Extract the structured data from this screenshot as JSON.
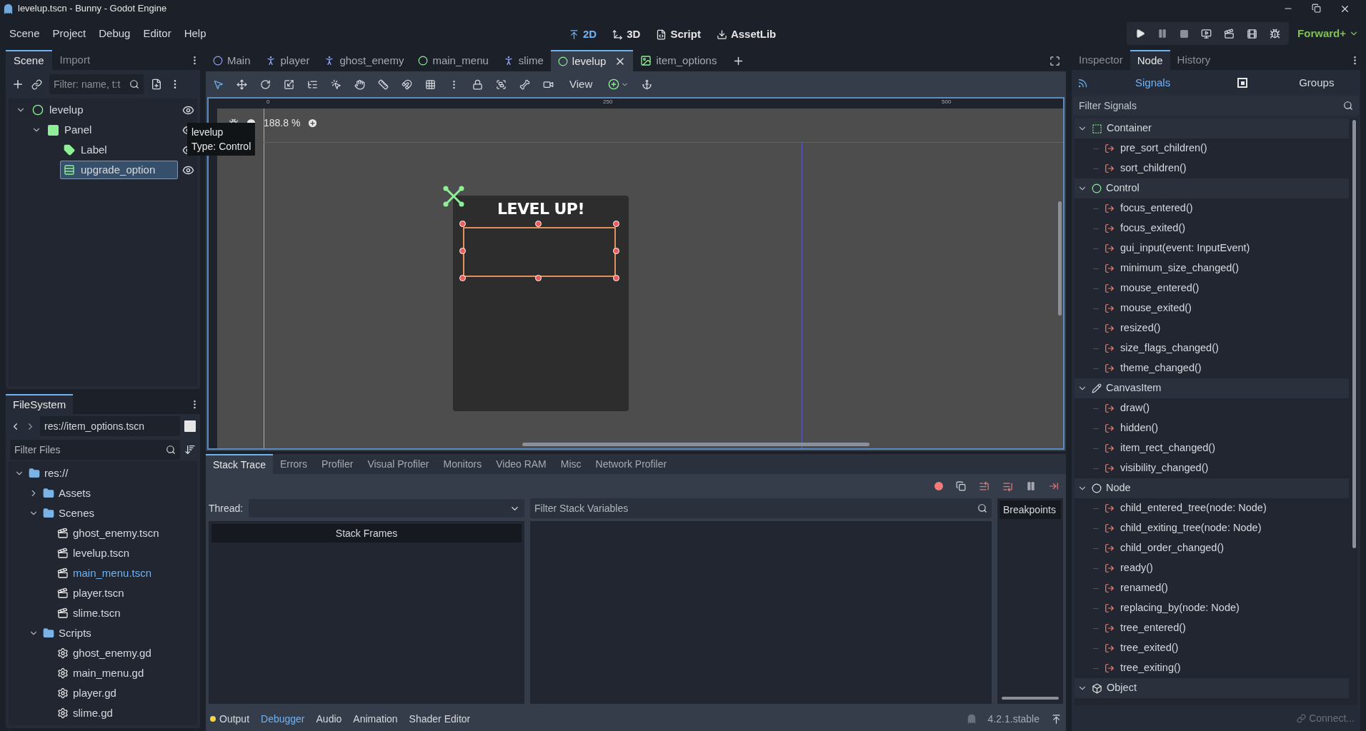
{
  "window": {
    "title": "levelup.tscn - Bunny - Godot Engine"
  },
  "menus": [
    "Scene",
    "Project",
    "Debug",
    "Editor",
    "Help"
  ],
  "main_screens": [
    {
      "label": "2D",
      "kind": "twod",
      "selected": true
    },
    {
      "label": "3D",
      "kind": "threed",
      "selected": false
    },
    {
      "label": "Script",
      "kind": "script",
      "selected": false
    },
    {
      "label": "AssetLib",
      "kind": "assetlib",
      "selected": false
    }
  ],
  "renderer": "Forward+",
  "scene_dock": {
    "tabs": [
      {
        "label": "Scene",
        "selected": true
      },
      {
        "label": "Import",
        "selected": false
      }
    ],
    "placeholder": "Filter: name, t:t",
    "tree": [
      {
        "name": "levelup",
        "kind": "control",
        "expanded": true,
        "selected": false,
        "children": [
          {
            "name": "Panel",
            "kind": "panel",
            "expanded": true,
            "selected": false,
            "children": [
              {
                "name": "Label",
                "kind": "label",
                "selected": false
              },
              {
                "name": "upgrade_option",
                "kind": "vbox",
                "selected": true
              }
            ]
          }
        ]
      }
    ],
    "tooltip": [
      "levelup",
      "Type: Control"
    ]
  },
  "scene_tabs": [
    {
      "label": "Main",
      "kind": "node2d",
      "selected": false
    },
    {
      "label": "player",
      "kind": "character",
      "selected": false
    },
    {
      "label": "ghost_enemy",
      "kind": "character",
      "selected": false
    },
    {
      "label": "main_menu",
      "kind": "control",
      "selected": false
    },
    {
      "label": "slime",
      "kind": "character",
      "selected": false
    },
    {
      "label": "levelup",
      "kind": "control",
      "selected": true
    },
    {
      "label": "item_options",
      "kind": "texture",
      "selected": false
    }
  ],
  "viewport": {
    "view_menu": "View",
    "zoom": "188.8 %",
    "ruler_marks": [
      "0",
      "250",
      "500"
    ],
    "panel_title": "LEVEL UP!"
  },
  "filesystem": {
    "tab": "FileSystem",
    "path": "res://item_options.tscn",
    "placeholder": "Filter Files",
    "tree": [
      {
        "name": "res://",
        "kind": "folder",
        "expanded": true,
        "highlighted": false,
        "children": [
          {
            "name": "Assets",
            "kind": "folder",
            "expanded": false,
            "highlighted": false
          },
          {
            "name": "Scenes",
            "kind": "folder",
            "expanded": true,
            "highlighted": false,
            "children": [
              {
                "name": "ghost_enemy.tscn",
                "kind": "scene",
                "highlighted": false
              },
              {
                "name": "levelup.tscn",
                "kind": "scene",
                "highlighted": false
              },
              {
                "name": "main_menu.tscn",
                "kind": "scene",
                "highlighted": true
              },
              {
                "name": "player.tscn",
                "kind": "scene",
                "highlighted": false
              },
              {
                "name": "slime.tscn",
                "kind": "scene",
                "highlighted": false
              }
            ]
          },
          {
            "name": "Scripts",
            "kind": "folder",
            "expanded": true,
            "highlighted": false,
            "children": [
              {
                "name": "ghost_enemy.gd",
                "kind": "script",
                "highlighted": false
              },
              {
                "name": "main_menu.gd",
                "kind": "script",
                "highlighted": false
              },
              {
                "name": "player.gd",
                "kind": "script",
                "highlighted": false
              },
              {
                "name": "slime.gd",
                "kind": "script",
                "highlighted": false
              }
            ]
          }
        ]
      }
    ]
  },
  "debugger": {
    "tabs": [
      {
        "label": "Stack Trace",
        "selected": true
      },
      {
        "label": "Errors",
        "selected": false
      },
      {
        "label": "Profiler",
        "selected": false
      },
      {
        "label": "Visual Profiler",
        "selected": false
      },
      {
        "label": "Monitors",
        "selected": false
      },
      {
        "label": "Video RAM",
        "selected": false
      },
      {
        "label": "Misc",
        "selected": false
      },
      {
        "label": "Network Profiler",
        "selected": false
      }
    ],
    "thread_label": "Thread:",
    "stack_frames": "Stack Frames",
    "placeholder": "Filter Stack Variables",
    "breakpoints": "Breakpoints"
  },
  "bottom_tabs": [
    {
      "label": "Output",
      "selected": false,
      "notice": true
    },
    {
      "label": "Debugger",
      "selected": true,
      "notice": false
    },
    {
      "label": "Audio",
      "selected": false,
      "notice": false
    },
    {
      "label": "Animation",
      "selected": false,
      "notice": false
    },
    {
      "label": "Shader Editor",
      "selected": false,
      "notice": false
    }
  ],
  "version": "4.2.1.stable",
  "inspector": {
    "tabs": [
      {
        "label": "Inspector",
        "selected": false
      },
      {
        "label": "Node",
        "selected": true
      },
      {
        "label": "History",
        "selected": false
      }
    ],
    "subtabs": [
      {
        "label": "Signals",
        "selected": true
      },
      {
        "label": "Groups",
        "selected": false
      }
    ],
    "placeholder": "Filter Signals",
    "groups": [
      {
        "name": "Container",
        "kind": "container",
        "expanded": true,
        "signals": [
          "pre_sort_children()",
          "sort_children()"
        ]
      },
      {
        "name": "Control",
        "kind": "control",
        "expanded": true,
        "signals": [
          "focus_entered()",
          "focus_exited()",
          "gui_input(event: InputEvent)",
          "minimum_size_changed()",
          "mouse_entered()",
          "mouse_exited()",
          "resized()",
          "size_flags_changed()",
          "theme_changed()"
        ]
      },
      {
        "name": "CanvasItem",
        "kind": "canvasitem",
        "expanded": true,
        "signals": [
          "draw()",
          "hidden()",
          "item_rect_changed()",
          "visibility_changed()"
        ]
      },
      {
        "name": "Node",
        "kind": "node",
        "expanded": true,
        "signals": [
          "child_entered_tree(node: Node)",
          "child_exiting_tree(node: Node)",
          "child_order_changed()",
          "ready()",
          "renamed()",
          "replacing_by(node: Node)",
          "tree_entered()",
          "tree_exited()",
          "tree_exiting()"
        ]
      },
      {
        "name": "Object",
        "kind": "object",
        "expanded": true
      }
    ],
    "connect_button": "Connect..."
  }
}
